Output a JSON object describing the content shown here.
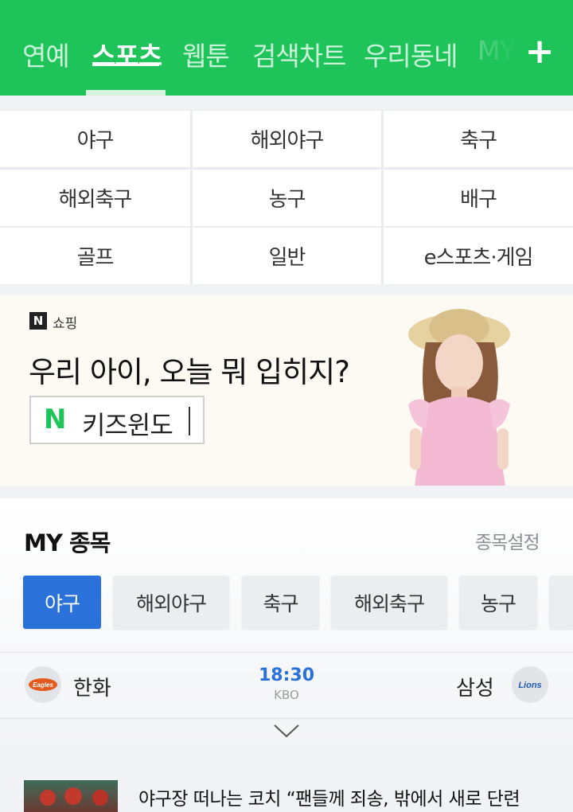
{
  "nav": {
    "tabs": [
      "연예",
      "스포츠",
      "웹툰",
      "검색차트",
      "우리동네",
      "MY"
    ],
    "active": "스포츠",
    "plus": "+"
  },
  "categories": [
    "야구",
    "해외야구",
    "축구",
    "해외축구",
    "농구",
    "배구",
    "골프",
    "일반",
    "e스포츠·게임"
  ],
  "banner": {
    "brand": "N",
    "brand_label": "쇼핑",
    "headline": "우리 아이, 오늘 뭐 입히지?",
    "search_logo": "N",
    "search_text": "키즈윈도"
  },
  "my": {
    "title": "MY 종목",
    "setting": "종목설정",
    "chips": [
      "야구",
      "해외야구",
      "축구",
      "해외축구",
      "농구"
    ],
    "active_chip": "야구",
    "match": {
      "home": "한화",
      "away": "삼성",
      "time": "18:30",
      "league": "KBO",
      "home_logo_text": "Eagles",
      "away_logo_text": "Lions"
    }
  },
  "news": {
    "title": "야구장 떠나는 코치 “팬들께 죄송, 밖에서 새로 단련"
  },
  "colors": {
    "brand_green": "#1ec35a",
    "chip_active": "#2a72d9"
  }
}
